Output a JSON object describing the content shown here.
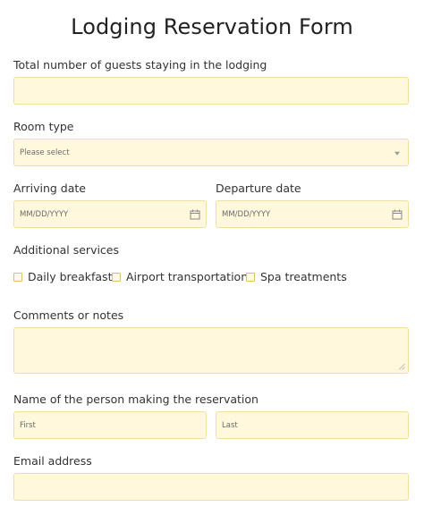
{
  "form": {
    "title": "Lodging Reservation Form",
    "guests_label": "Total number of guests staying in the lodging",
    "guests_value": "",
    "room_type_label": "Room type",
    "room_type_value": "Please select",
    "arriving_label": "Arriving date",
    "arriving_placeholder": "MM/DD/YYYY",
    "departure_label": "Departure date",
    "departure_placeholder": "MM/DD/YYYY",
    "services_label": "Additional services",
    "services": [
      {
        "label": "Daily breakfast",
        "checked": false
      },
      {
        "label": "Airport transportation",
        "checked": false
      },
      {
        "label": "Spa treatments",
        "checked": false
      }
    ],
    "comments_label": "Comments or notes",
    "comments_value": "",
    "name_label": "Name of the person making the reservation",
    "first_placeholder": "First",
    "last_placeholder": "Last",
    "email_label": "Email address",
    "email_value": ""
  },
  "colors": {
    "field_background": "#fff8dc",
    "field_border": "#f0dfa0",
    "checkbox_border": "#e0c060"
  },
  "icons": {
    "select_caret": "chevron-down-icon",
    "date_picker": "calendar-icon"
  }
}
